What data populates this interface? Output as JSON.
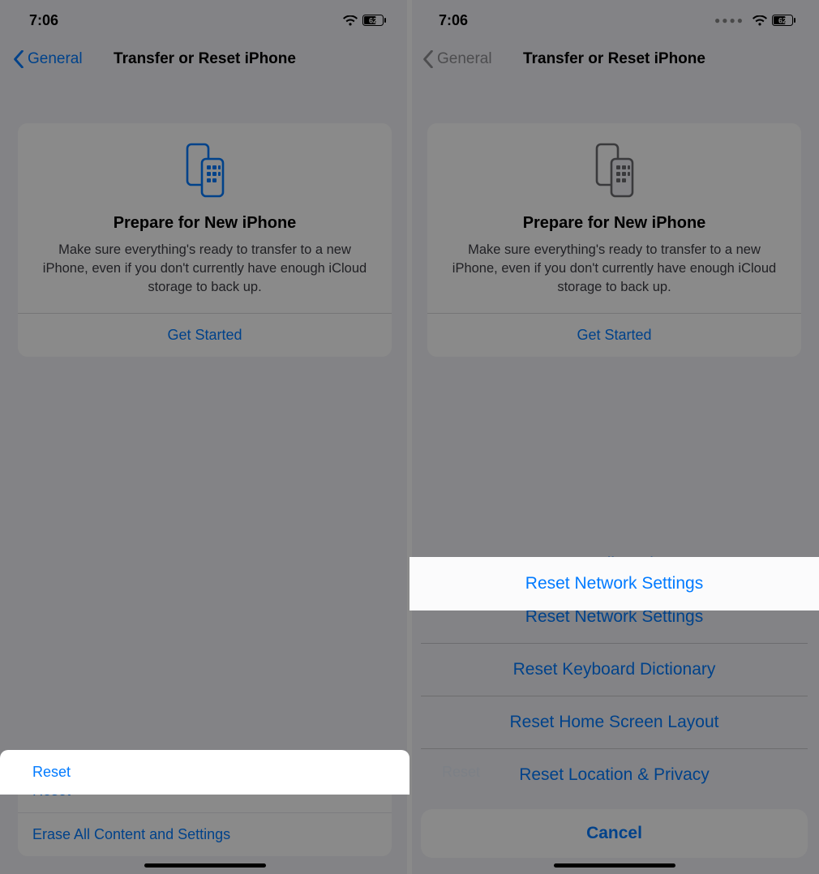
{
  "status": {
    "time": "7:06",
    "battery": "62"
  },
  "nav": {
    "back": "General",
    "title": "Transfer or Reset iPhone"
  },
  "card": {
    "title": "Prepare for New iPhone",
    "body": "Make sure everything's ready to transfer to a new iPhone, even if you don't currently have enough iCloud storage to back up.",
    "cta": "Get Started"
  },
  "list": {
    "reset": "Reset",
    "erase": "Erase All Content and Settings"
  },
  "sheet": {
    "options": [
      "Reset All Settings",
      "Reset Network Settings",
      "Reset Keyboard Dictionary",
      "Reset Home Screen Layout",
      "Reset Location & Privacy"
    ],
    "cancel": "Cancel"
  },
  "colors": {
    "accent": "#007aff"
  }
}
